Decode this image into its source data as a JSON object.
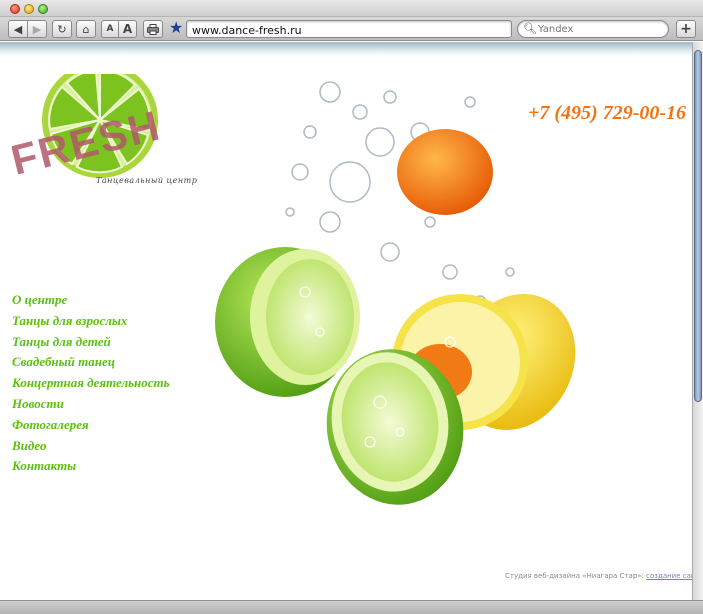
{
  "browser": {
    "url": "www.dance-fresh.ru",
    "search_placeholder": "Yandex",
    "font_small_label": "A",
    "font_big_label": "A",
    "add_tab_label": "+"
  },
  "logo": {
    "wordmark": "FRESH",
    "subtitle": "Танцевальный центр"
  },
  "header": {
    "phone": "+7 (495) 729-00-16"
  },
  "menu": {
    "items": [
      "О центре",
      "Танцы для взрослых",
      "Танцы для детей",
      "Свадебный танец",
      "Концертная деятельность",
      "Новости",
      "Фотогалерея",
      "Видео",
      "Контакты"
    ]
  },
  "footer": {
    "credit": "Студия веб-дизайна «Ниагара Стар»: ",
    "link": "создание сайта"
  },
  "colors": {
    "menu": "#5cc10e",
    "phone": "#f07414",
    "logo_stamp": "#b0586a",
    "lime": "#7cc320",
    "lemon": "#f2d515",
    "orange": "#f07a10"
  }
}
